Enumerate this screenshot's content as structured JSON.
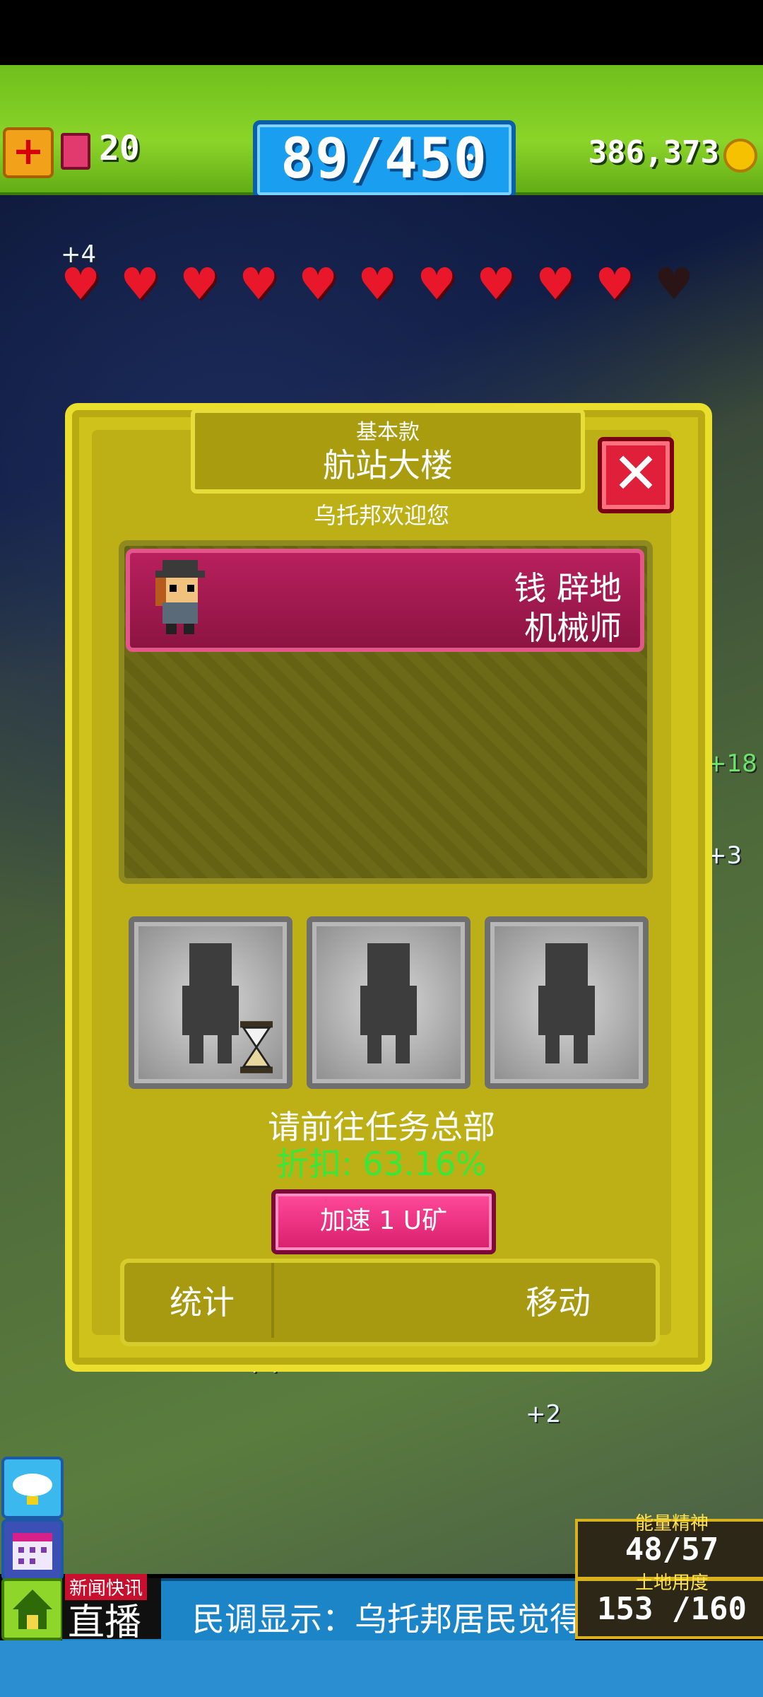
{
  "topbar": {
    "tickets": "20",
    "population": "89/450",
    "coins": "386,373"
  },
  "hearts": {
    "filled": 10,
    "total": 11
  },
  "dialog": {
    "subtitle": "基本款",
    "title": "航站大楼",
    "welcome": "乌托邦欢迎您",
    "resident": {
      "name": "钱 辟地",
      "job": "机械师"
    },
    "slots_total": 3,
    "go_text": "请前往任务总部",
    "discount": "折扣: 63.16%",
    "speed_button": "加速 1 U矿",
    "tab_stats": "统计",
    "tab_move": "移动"
  },
  "widgets": {
    "energy_label": "能量精神",
    "energy_value": "48/57",
    "land_label": "土地用度",
    "land_value": "153 /160"
  },
  "ticker": {
    "news_label": "新闻快讯",
    "live": "直播",
    "text": "民调显示：乌托邦居民觉得"
  },
  "colors": {
    "dialog_yellow": "#cfc21a",
    "close_red": "#e0203a",
    "speed_pink": "#d81e6c",
    "discount_green": "#37e83a",
    "resident_magenta": "#b8205d"
  },
  "icons": [
    "plus-icon",
    "ticket-icon",
    "coin-icon",
    "heart-icon",
    "close-icon",
    "silhouette-icon",
    "hourglass-icon",
    "cloud-icon",
    "calendar-icon",
    "home-icon"
  ]
}
